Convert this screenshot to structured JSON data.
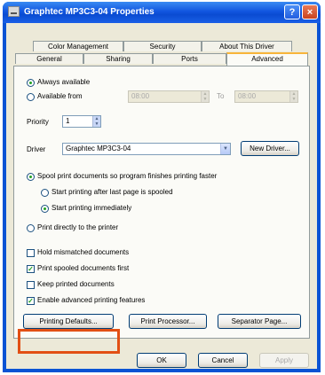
{
  "window": {
    "title": "Graphtec MP3C3-04 Properties",
    "help_symbol": "?",
    "close_symbol": "×"
  },
  "tabs": {
    "row1": [
      "Color Management",
      "Security",
      "About This Driver"
    ],
    "row2": [
      "General",
      "Sharing",
      "Ports",
      "Advanced"
    ],
    "active": "Advanced"
  },
  "availability": {
    "always_label": "Always available",
    "from_label": "Available from",
    "from_time": "08:00",
    "to_label": "To",
    "to_time": "08:00",
    "selected": "always"
  },
  "priority": {
    "label": "Priority",
    "value": "1"
  },
  "driver": {
    "label": "Driver",
    "value": "Graphtec MP3C3-04",
    "new_driver_button": "New Driver..."
  },
  "spool": {
    "spool_label": "Spool print documents so program finishes printing faster",
    "after_last_page_label": "Start printing after last page is spooled",
    "immediately_label": "Start printing immediately",
    "direct_label": "Print directly to the printer"
  },
  "options": [
    {
      "label": "Hold mismatched documents",
      "checked": false
    },
    {
      "label": "Print spooled documents first",
      "checked": true
    },
    {
      "label": "Keep printed documents",
      "checked": false
    },
    {
      "label": "Enable advanced printing features",
      "checked": true
    }
  ],
  "buttons": {
    "printing_defaults": "Printing Defaults...",
    "print_processor": "Print Processor...",
    "separator_page": "Separator Page...",
    "ok": "OK",
    "cancel": "Cancel",
    "apply": "Apply"
  },
  "colors": {
    "highlight": "#e24f14",
    "titlebar": "#0a53d4",
    "dialog_bg": "#ece9d8"
  }
}
